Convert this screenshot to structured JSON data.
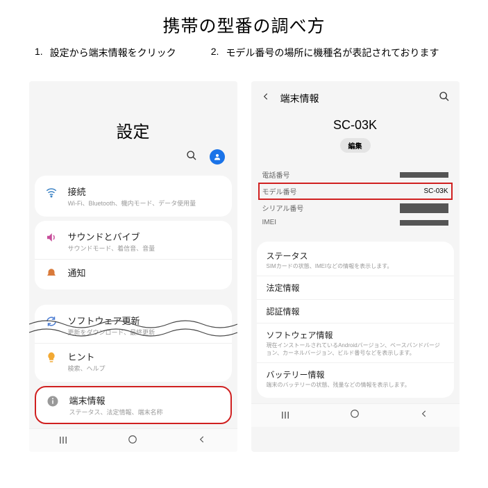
{
  "title": "携帯の型番の調べ方",
  "steps": [
    {
      "num": "1.",
      "text": "設定から端末情報をクリック"
    },
    {
      "num": "2.",
      "text": "モデル番号の場所に機種名が表記されております"
    }
  ],
  "settings": {
    "title": "設定",
    "items": [
      {
        "title": "接続",
        "sub": "Wi-Fi、Bluetooth、機内モード、データ使用量"
      },
      {
        "title": "サウンドとバイブ",
        "sub": "サウンドモード、着信音、音量"
      },
      {
        "title": "通知",
        "sub": ""
      },
      {
        "title": "ソフトウェア更新",
        "sub": "更新をダウンロード、最終更新"
      },
      {
        "title": "ヒント",
        "sub": "検索、ヘルプ"
      },
      {
        "title": "端末情報",
        "sub": "ステータス、法定情報、端末名称"
      }
    ]
  },
  "device": {
    "header": "端末情報",
    "model": "SC-03K",
    "edit": "編集",
    "rows": [
      {
        "label": "電話番号",
        "value": ""
      },
      {
        "label": "モデル番号",
        "value": "SC-03K",
        "highlight": true
      },
      {
        "label": "シリアル番号",
        "value": ""
      },
      {
        "label": "IMEI",
        "value": ""
      }
    ],
    "sections": [
      {
        "title": "ステータス",
        "sub": "SIMカードの状態、IMEIなどの情報を表示します。"
      },
      {
        "title": "法定情報",
        "sub": ""
      },
      {
        "title": "認証情報",
        "sub": ""
      },
      {
        "title": "ソフトウェア情報",
        "sub": "現在インストールされているAndroidバージョン、ベースバンドバージョン、カーネルバージョン、ビルド番号などを表示します。"
      },
      {
        "title": "バッテリー情報",
        "sub": "端末のバッテリーの状態、残量などの情報を表示します。"
      }
    ]
  }
}
